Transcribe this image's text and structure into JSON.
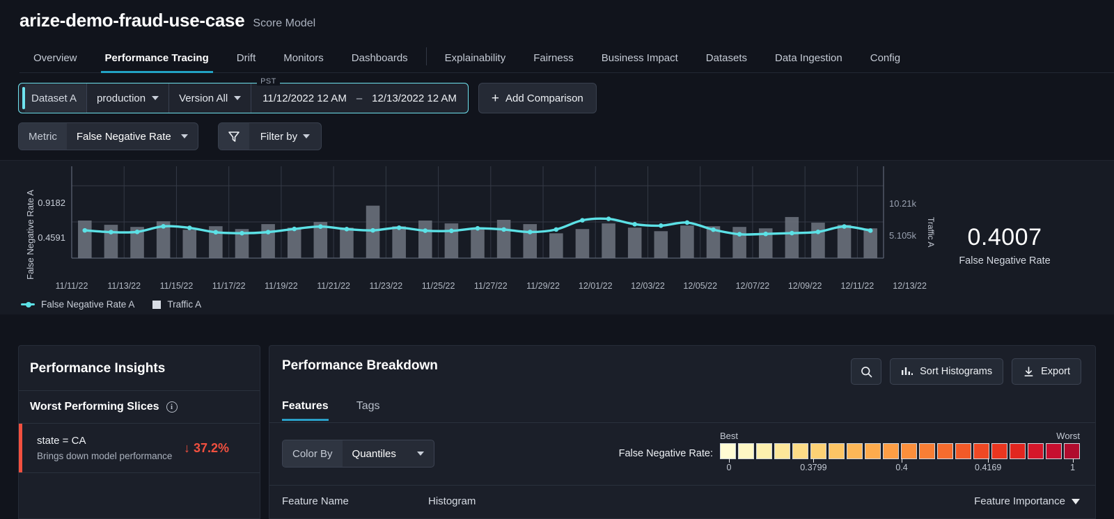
{
  "header": {
    "model_title": "arize-demo-fraud-use-case",
    "model_subtitle": "Score Model",
    "tabs": [
      {
        "label": "Overview",
        "active": false
      },
      {
        "label": "Performance Tracing",
        "active": true
      },
      {
        "label": "Drift",
        "active": false
      },
      {
        "label": "Monitors",
        "active": false
      },
      {
        "label": "Dashboards",
        "active": false
      },
      {
        "label": "Explainability",
        "active": false
      },
      {
        "label": "Fairness",
        "active": false
      },
      {
        "label": "Business Impact",
        "active": false
      },
      {
        "label": "Datasets",
        "active": false
      },
      {
        "label": "Data Ingestion",
        "active": false
      },
      {
        "label": "Config",
        "active": false
      }
    ]
  },
  "filters": {
    "dataset_label": "Dataset A",
    "environment": "production",
    "version": "Version All",
    "timezone": "PST",
    "date_start": "11/12/2022 12 AM",
    "date_dash": "–",
    "date_end": "12/13/2022 12 AM",
    "add_comparison": "Add Comparison",
    "metric_label": "Metric",
    "metric_value": "False Negative Rate",
    "filter_by": "Filter by"
  },
  "chart_data": {
    "type": "line",
    "title": "",
    "ylabel": "False Negative Rate A",
    "y2label": "Traffic A",
    "xlabel": "",
    "yticks": [
      "0.4591",
      "0.9182"
    ],
    "y2ticks": [
      "5.105k",
      "10.21k"
    ],
    "ylim": [
      0,
      1.1478
    ],
    "y2lim": [
      0,
      12762
    ],
    "grid": true,
    "legend_position": "bottom-left",
    "legend": [
      "False Negative Rate A",
      "Traffic A"
    ],
    "big_value": "0.4007",
    "big_value_label": "False Negative Rate",
    "xticks": [
      "11/11/22",
      "11/13/22",
      "11/15/22",
      "11/17/22",
      "11/19/22",
      "11/21/22",
      "11/23/22",
      "11/25/22",
      "11/27/22",
      "11/29/22",
      "12/01/22",
      "12/03/22",
      "12/05/22",
      "12/07/22",
      "12/09/22",
      "12/11/22",
      "12/13/22"
    ],
    "x": [
      "11/12/22",
      "11/13/22",
      "11/14/22",
      "11/15/22",
      "11/16/22",
      "11/17/22",
      "11/18/22",
      "11/19/22",
      "11/20/22",
      "11/21/22",
      "11/22/22",
      "11/23/22",
      "11/24/22",
      "11/25/22",
      "11/26/22",
      "11/27/22",
      "11/28/22",
      "11/29/22",
      "11/30/22",
      "12/01/22",
      "12/02/22",
      "12/03/22",
      "12/04/22",
      "12/05/22",
      "12/06/22",
      "12/07/22",
      "12/08/22",
      "12/09/22",
      "12/10/22",
      "12/11/22",
      "12/12/22"
    ],
    "series": [
      {
        "name": "False Negative Rate A",
        "type": "line",
        "color": "#5ce1e6",
        "axis": "left",
        "values": [
          0.352,
          0.33,
          0.333,
          0.403,
          0.384,
          0.328,
          0.316,
          0.33,
          0.37,
          0.4,
          0.368,
          0.352,
          0.386,
          0.348,
          0.346,
          0.378,
          0.363,
          0.331,
          0.363,
          0.48,
          0.498,
          0.43,
          0.412,
          0.451,
          0.361,
          0.303,
          0.307,
          0.317,
          0.333,
          0.401,
          0.349
        ]
      },
      {
        "name": "Traffic A",
        "type": "bar",
        "color": "#6e7480",
        "axis": "right",
        "values": [
          5300,
          4700,
          4400,
          5200,
          4000,
          4500,
          4100,
          4800,
          4300,
          5100,
          4300,
          7400,
          4500,
          5300,
          4900,
          4200,
          5400,
          4800,
          3500,
          4100,
          4900,
          4300,
          3800,
          4600,
          4500,
          4400,
          4200,
          5800,
          5000,
          4700,
          4200
        ]
      }
    ]
  },
  "insights": {
    "panel_title": "Performance Insights",
    "section_title": "Worst Performing Slices",
    "slices": [
      {
        "name": "state = CA",
        "description": "Brings down model performance",
        "delta": "↓ 37.2%",
        "delta_color": "#f2503f"
      }
    ]
  },
  "breakdown": {
    "title": "Performance Breakdown",
    "search_label": "Search",
    "sort_label": "Sort Histograms",
    "export_label": "Export",
    "tabs": [
      {
        "label": "Features",
        "active": true
      },
      {
        "label": "Tags",
        "active": false
      }
    ],
    "color_by_label": "Color By",
    "color_by_value": "Quantiles",
    "scale_metric_label": "False Negative Rate:",
    "scale_best": "Best",
    "scale_worst": "Worst",
    "scale_ticks": [
      {
        "label": "0",
        "pos": 2.5
      },
      {
        "label": "0.3799",
        "pos": 26.0
      },
      {
        "label": "0.4",
        "pos": 50.5
      },
      {
        "label": "0.4169",
        "pos": 74.5
      },
      {
        "label": "1",
        "pos": 98.0
      }
    ],
    "scale_colors": [
      "#fffbd3",
      "#fef7c4",
      "#fdf0ae",
      "#fde69a",
      "#fddc87",
      "#fdd175",
      "#fdc565",
      "#fdb757",
      "#fdab4d",
      "#fd9e45",
      "#fb8f3c",
      "#f87e35",
      "#f56c2e",
      "#f25a28",
      "#ee4824",
      "#e93620",
      "#e1261f",
      "#d5172a",
      "#c70f2f",
      "#b00c2e"
    ],
    "table_headers": {
      "feature_name": "Feature Name",
      "histogram": "Histogram",
      "feature_importance": "Feature Importance"
    }
  }
}
